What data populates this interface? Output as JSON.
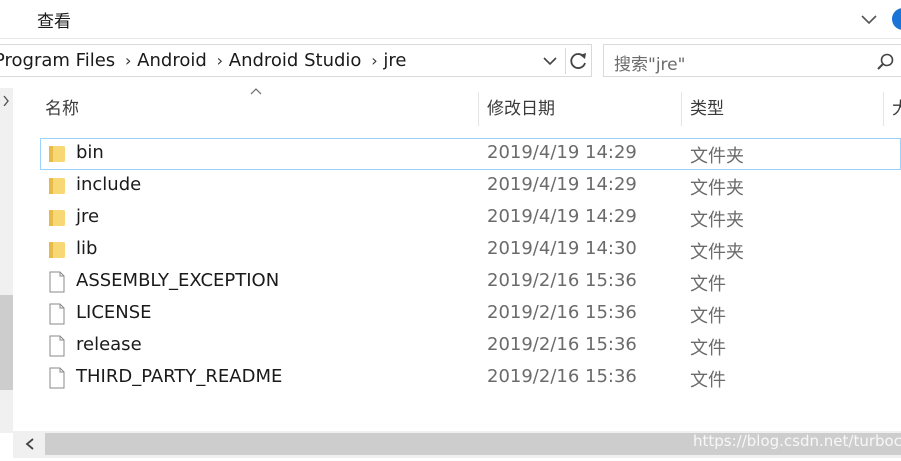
{
  "ribbon": {
    "tab_label": "查看"
  },
  "address": {
    "crumbs": [
      "Program Files",
      "Android",
      "Android Studio",
      "jre"
    ]
  },
  "search": {
    "placeholder": "搜索\"jre\""
  },
  "columns": {
    "name": "名称",
    "date": "修改日期",
    "type": "类型",
    "size": "大"
  },
  "files": [
    {
      "name": "bin",
      "date": "2019/4/19 14:29",
      "type": "文件夹",
      "icon": "folder-icon"
    },
    {
      "name": "include",
      "date": "2019/4/19 14:29",
      "type": "文件夹",
      "icon": "folder-icon"
    },
    {
      "name": "jre",
      "date": "2019/4/19 14:29",
      "type": "文件夹",
      "icon": "folder-icon"
    },
    {
      "name": "lib",
      "date": "2019/4/19 14:30",
      "type": "文件夹",
      "icon": "folder-icon"
    },
    {
      "name": "ASSEMBLY_EXCEPTION",
      "date": "2019/2/16 15:36",
      "type": "文件",
      "icon": "file-icon"
    },
    {
      "name": "LICENSE",
      "date": "2019/2/16 15:36",
      "type": "文件",
      "icon": "file-icon"
    },
    {
      "name": "release",
      "date": "2019/2/16 15:36",
      "type": "文件",
      "icon": "file-icon"
    },
    {
      "name": "THIRD_PARTY_README",
      "date": "2019/2/16 15:36",
      "type": "文件",
      "icon": "file-icon"
    }
  ],
  "watermark": "https://blog.csdn.net/turbock",
  "colors": {
    "folder": "#f8d775",
    "focus_outline": "#99d1ff",
    "accent": "#1a73d6"
  }
}
